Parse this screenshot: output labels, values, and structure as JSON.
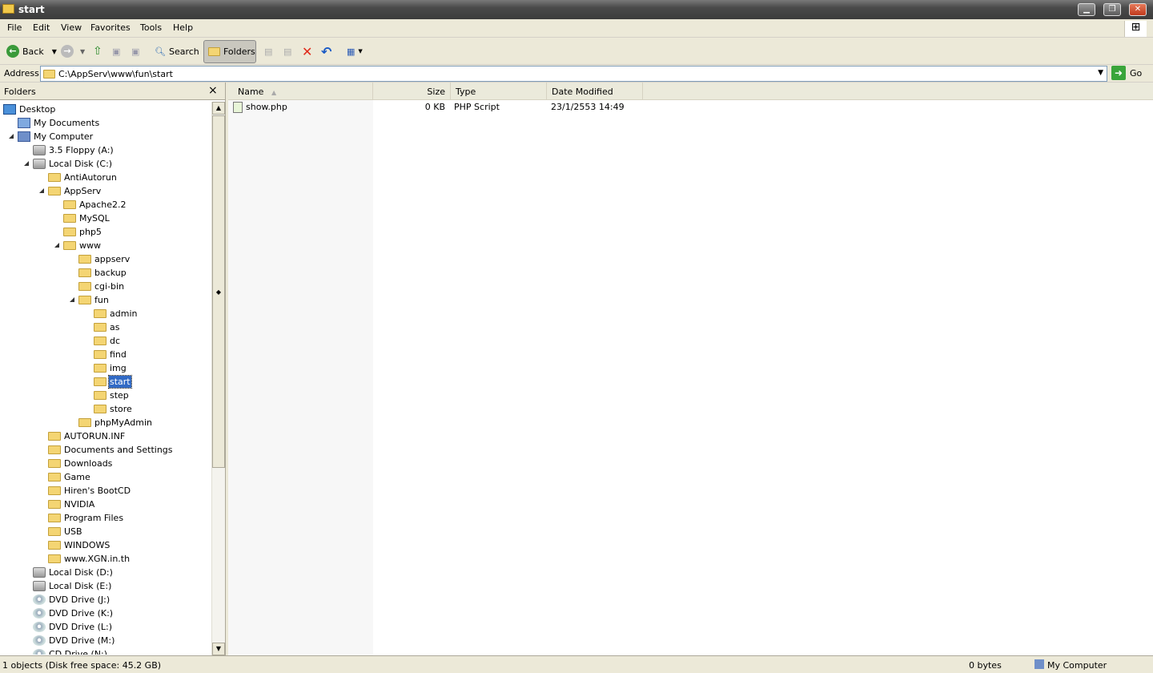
{
  "window": {
    "title": "start"
  },
  "menu": [
    "File",
    "Edit",
    "View",
    "Favorites",
    "Tools",
    "Help"
  ],
  "toolbar": {
    "back": "Back",
    "search": "Search",
    "folders": "Folders"
  },
  "address": {
    "label": "Address",
    "value": "C:\\AppServ\\www\\fun\\start",
    "go": "Go"
  },
  "folders_pane": {
    "title": "Folders",
    "close": "×"
  },
  "tree": [
    {
      "label": "Desktop",
      "level": 0,
      "exp": "",
      "icon": "desk"
    },
    {
      "label": "My Documents",
      "level": 1,
      "exp": "c",
      "icon": "docs"
    },
    {
      "label": "My Computer",
      "level": 1,
      "exp": "e",
      "icon": "pc"
    },
    {
      "label": "3.5 Floppy (A:)",
      "level": 2,
      "exp": "c",
      "icon": "drive"
    },
    {
      "label": "Local Disk (C:)",
      "level": 2,
      "exp": "e",
      "icon": "drive"
    },
    {
      "label": "AntiAutorun",
      "level": 3,
      "exp": "",
      "icon": "folder"
    },
    {
      "label": "AppServ",
      "level": 3,
      "exp": "e",
      "icon": "folder"
    },
    {
      "label": "Apache2.2",
      "level": 4,
      "exp": "c",
      "icon": "folder"
    },
    {
      "label": "MySQL",
      "level": 4,
      "exp": "c",
      "icon": "folder"
    },
    {
      "label": "php5",
      "level": 4,
      "exp": "c",
      "icon": "folder"
    },
    {
      "label": "www",
      "level": 4,
      "exp": "e",
      "icon": "folder"
    },
    {
      "label": "appserv",
      "level": 5,
      "exp": "",
      "icon": "folder"
    },
    {
      "label": "backup",
      "level": 5,
      "exp": "",
      "icon": "folder"
    },
    {
      "label": "cgi-bin",
      "level": 5,
      "exp": "",
      "icon": "folder"
    },
    {
      "label": "fun",
      "level": 5,
      "exp": "e",
      "icon": "folder"
    },
    {
      "label": "admin",
      "level": 6,
      "exp": "",
      "icon": "folder"
    },
    {
      "label": "as",
      "level": 6,
      "exp": "",
      "icon": "folder"
    },
    {
      "label": "dc",
      "level": 6,
      "exp": "",
      "icon": "folder"
    },
    {
      "label": "find",
      "level": 6,
      "exp": "",
      "icon": "folder"
    },
    {
      "label": "img",
      "level": 6,
      "exp": "c",
      "icon": "folder"
    },
    {
      "label": "start",
      "level": 6,
      "exp": "",
      "icon": "folder",
      "selected": true
    },
    {
      "label": "step",
      "level": 6,
      "exp": "",
      "icon": "folder"
    },
    {
      "label": "store",
      "level": 6,
      "exp": "",
      "icon": "folder"
    },
    {
      "label": "phpMyAdmin",
      "level": 5,
      "exp": "c",
      "icon": "folder"
    },
    {
      "label": "AUTORUN.INF",
      "level": 3,
      "exp": "c",
      "icon": "folder"
    },
    {
      "label": "Documents and Settings",
      "level": 3,
      "exp": "c",
      "icon": "folder"
    },
    {
      "label": "Downloads",
      "level": 3,
      "exp": "c",
      "icon": "folder"
    },
    {
      "label": "Game",
      "level": 3,
      "exp": "c",
      "icon": "folder"
    },
    {
      "label": "Hiren's BootCD",
      "level": 3,
      "exp": "c",
      "icon": "folder"
    },
    {
      "label": "NVIDIA",
      "level": 3,
      "exp": "c",
      "icon": "folder"
    },
    {
      "label": "Program Files",
      "level": 3,
      "exp": "c",
      "icon": "folder"
    },
    {
      "label": "USB",
      "level": 3,
      "exp": "",
      "icon": "folder"
    },
    {
      "label": "WINDOWS",
      "level": 3,
      "exp": "c",
      "icon": "folder"
    },
    {
      "label": "www.XGN.in.th",
      "level": 3,
      "exp": "c",
      "icon": "folder"
    },
    {
      "label": "Local Disk (D:)",
      "level": 2,
      "exp": "c",
      "icon": "drive"
    },
    {
      "label": "Local Disk (E:)",
      "level": 2,
      "exp": "c",
      "icon": "drive"
    },
    {
      "label": "DVD Drive (J:)",
      "level": 2,
      "exp": "c",
      "icon": "dvd"
    },
    {
      "label": "DVD Drive (K:)",
      "level": 2,
      "exp": "c",
      "icon": "dvd"
    },
    {
      "label": "DVD Drive (L:)",
      "level": 2,
      "exp": "c",
      "icon": "dvd"
    },
    {
      "label": "DVD Drive (M:)",
      "level": 2,
      "exp": "c",
      "icon": "dvd"
    },
    {
      "label": "CD Drive (N:)",
      "level": 2,
      "exp": "c",
      "icon": "dvd"
    }
  ],
  "columns": {
    "name": "Name",
    "size": "Size",
    "type": "Type",
    "date": "Date Modified"
  },
  "files": [
    {
      "name": "show.php",
      "size": "0 KB",
      "type": "PHP Script",
      "date": "23/1/2553 14:49"
    }
  ],
  "status": {
    "left": "1 objects (Disk free space: 45.2 GB)",
    "size": "0 bytes",
    "zone": "My Computer"
  }
}
